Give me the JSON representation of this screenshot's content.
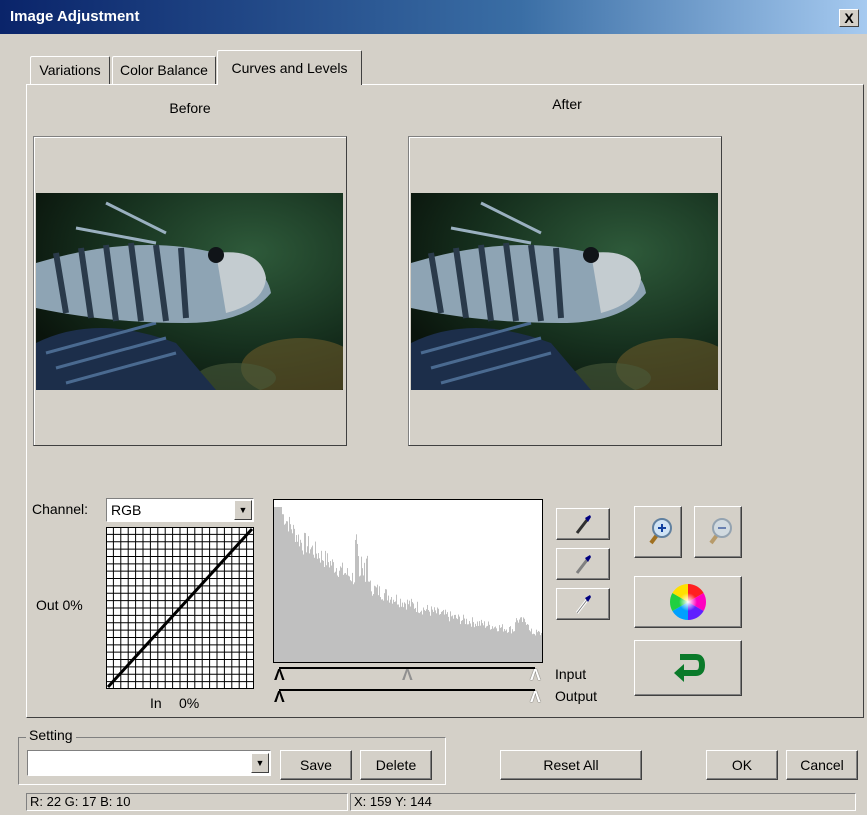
{
  "window": {
    "title": "Image Adjustment",
    "close_glyph": "X"
  },
  "tabs": [
    {
      "label": "Variations",
      "active": false
    },
    {
      "label": "Color Balance",
      "active": false
    },
    {
      "label": "Curves and Levels",
      "active": true
    }
  ],
  "preview": {
    "before_label": "Before",
    "after_label": "After"
  },
  "channel": {
    "label": "Channel:",
    "selected": "RGB"
  },
  "curve": {
    "out_label": "Out 0%",
    "in_label": "In",
    "in_value": "0%"
  },
  "levels": {
    "input_label": "Input",
    "output_label": "Output",
    "input_black": 0,
    "input_gray": 0.5,
    "input_white": 1,
    "output_black": 0,
    "output_white": 1
  },
  "tools": {
    "eyedropper_black": "eyedropper-black-icon",
    "eyedropper_gray": "eyedropper-gray-icon",
    "eyedropper_white": "eyedropper-white-icon",
    "zoom_in": "zoom-in-icon",
    "zoom_out": "zoom-out-icon",
    "color_wheel": "color-wheel-icon",
    "undo": "undo-arrow-icon"
  },
  "setting": {
    "legend": "Setting",
    "value": "",
    "save_label": "Save",
    "delete_label": "Delete"
  },
  "buttons": {
    "reset_all": "Reset All",
    "ok": "OK",
    "cancel": "Cancel"
  },
  "status": {
    "rgb": "R:  22 G:  17 B:  10",
    "xy": "X: 159   Y: 144"
  },
  "colors": {
    "titlebar_start": "#0a246a",
    "titlebar_end": "#a6caf0",
    "dialog_bg": "#d4d0c8",
    "histogram_fill": "#c0c0c0"
  }
}
